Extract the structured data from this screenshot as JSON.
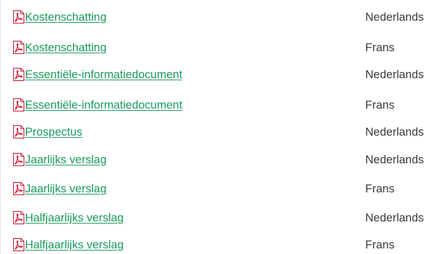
{
  "documents": [
    {
      "title": "Kostenschatting",
      "language": "Nederlands",
      "icon": "pdf-icon"
    },
    {
      "title": "Kostenschatting",
      "language": "Frans",
      "icon": "pdf-icon"
    },
    {
      "title": "Essentiële-informatiedocument",
      "language": "Nederlands",
      "icon": "pdf-icon"
    },
    {
      "title": "Essentiële-informatiedocument",
      "language": "Frans",
      "icon": "pdf-icon"
    },
    {
      "title": "Prospectus",
      "language": "Nederlands",
      "icon": "pdf-icon"
    },
    {
      "title": "Jaarlijks verslag",
      "language": "Nederlands",
      "icon": "pdf-icon"
    },
    {
      "title": "Jaarlijks verslag",
      "language": "Frans",
      "icon": "pdf-icon"
    },
    {
      "title": "Halfjaarlijks verslag",
      "language": "Nederlands",
      "icon": "pdf-icon"
    },
    {
      "title": "Halfjaarlijks verslag",
      "language": "Frans",
      "icon": "pdf-icon"
    }
  ],
  "colors": {
    "link": "#1a9a5a",
    "pdf_icon_red": "#c8102e",
    "text": "#3a3a3a"
  }
}
